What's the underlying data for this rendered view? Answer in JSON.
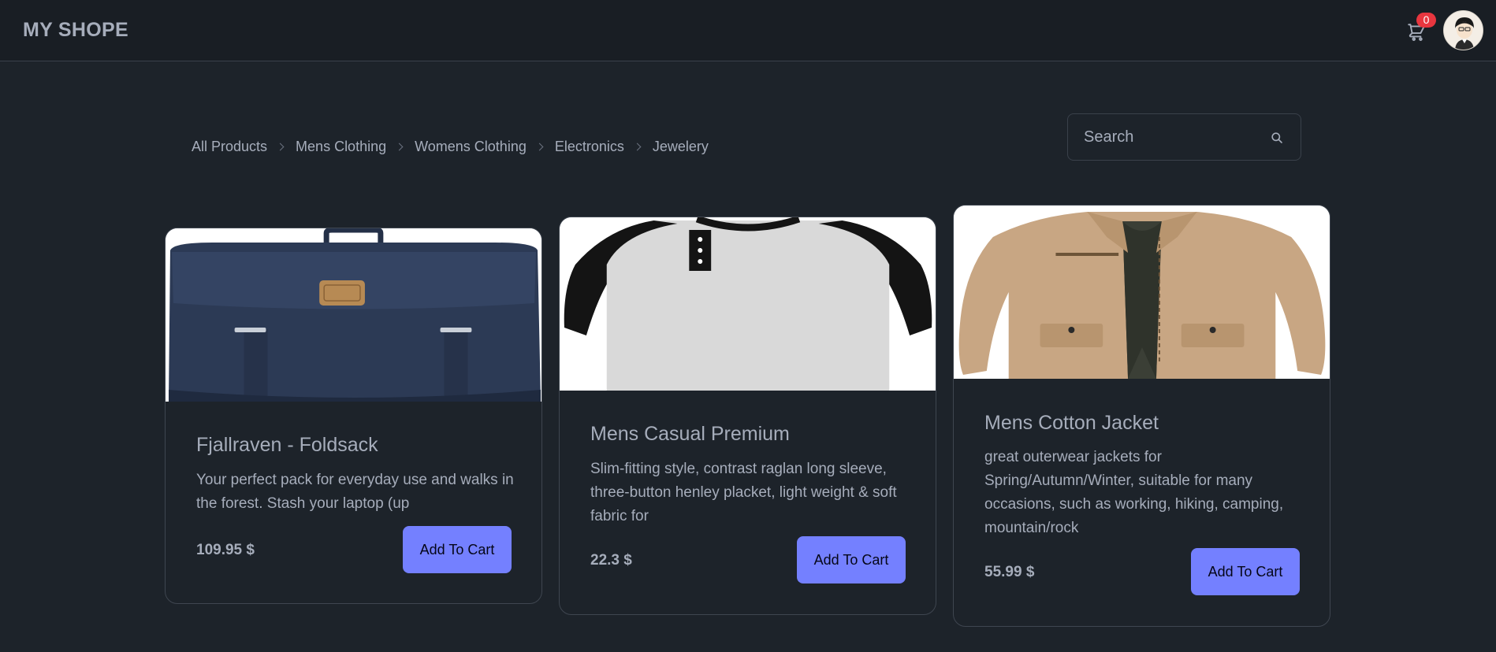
{
  "header": {
    "brand": "MY SHOPE",
    "cart_count": "0",
    "cart_icon": "cart-icon",
    "avatar_icon": "user-avatar"
  },
  "breadcrumb": [
    "All Products",
    "Mens Clothing",
    "Womens Clothing",
    "Electronics",
    "Jewelery"
  ],
  "search": {
    "placeholder": "Search",
    "icon": "search-icon"
  },
  "products": [
    {
      "title": "Fjallraven - Foldsack",
      "description": "Your perfect pack for everyday use and walks in the forest. Stash your laptop (up",
      "price": "109.95 $",
      "button": "Add To Cart"
    },
    {
      "title": "Mens Casual Premium",
      "description": "Slim-fitting style, contrast raglan long sleeve, three-button henley placket, light weight & soft fabric for",
      "price": "22.3 $",
      "button": "Add To Cart"
    },
    {
      "title": "Mens Cotton Jacket",
      "description": "great outerwear jackets for Spring/Autumn/Winter, suitable for many occasions, such as working, hiking, camping, mountain/rock",
      "price": "55.99 $",
      "button": "Add To Cart"
    }
  ],
  "colors": {
    "background": "#1d232a",
    "navbar": "#191e24",
    "primary_button": "#7480ff",
    "badge": "#e8363f",
    "text": "#a6adbb"
  }
}
